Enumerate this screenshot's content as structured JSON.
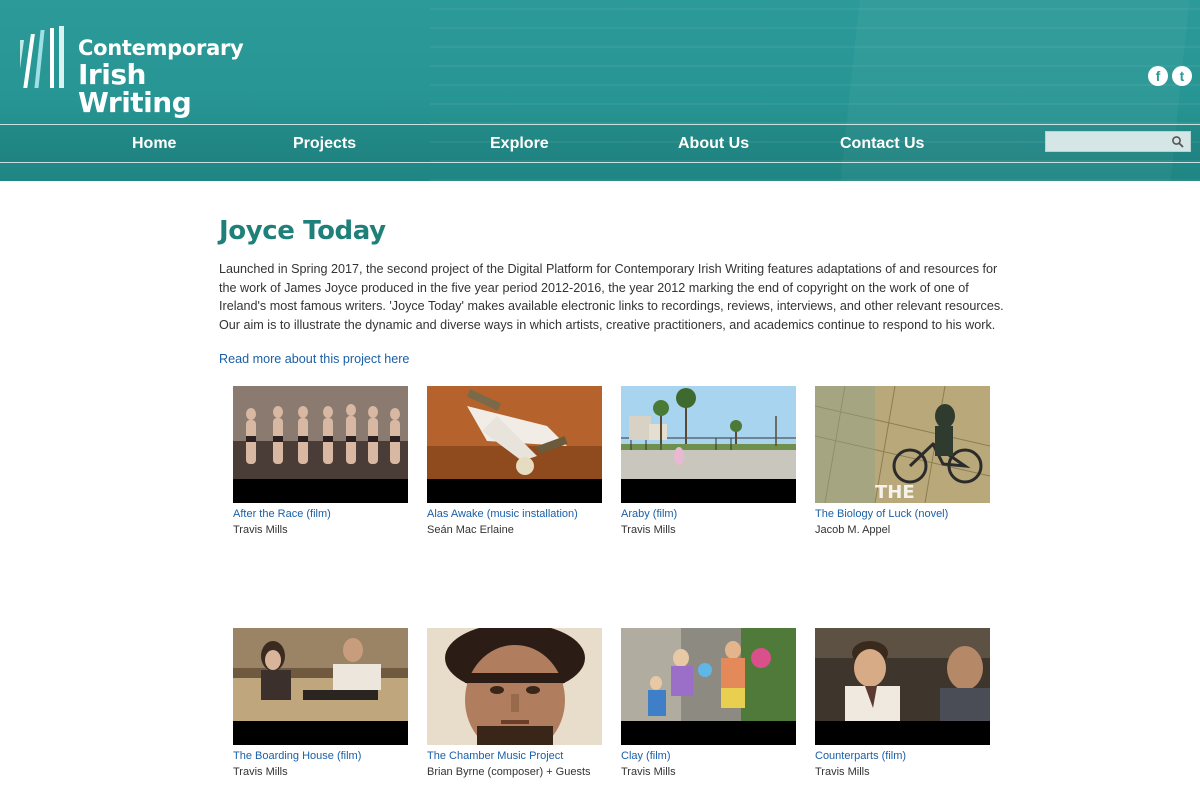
{
  "brand": {
    "line1": "Contemporary",
    "line2": "Irish Writing",
    "accent": "#1f7f79",
    "header_color": "#2b9a98"
  },
  "social": [
    {
      "icon": "facebook-icon",
      "glyph": "f"
    },
    {
      "icon": "twitter-icon",
      "glyph": "t"
    }
  ],
  "nav": {
    "items": [
      "Home",
      "Projects",
      "Explore",
      "About Us",
      "Contact Us"
    ]
  },
  "search": {
    "placeholder": ""
  },
  "page": {
    "title": "Joyce Today",
    "intro": "Launched in Spring 2017, the second project of the Digital Platform for Contemporary Irish Writing features adaptations of and resources for the work of James Joyce produced in the five year period 2012-2016, the year 2012 marking the end of copyright on the work of one of Ireland's most famous writers. 'Joyce Today' makes available electronic links to recordings, reviews, interviews, and other relevant resources. Our aim is to illustrate the dynamic and diverse ways in which artists, creative practitioners, and academics continue to respond to his work.",
    "read_more": "Read more about this project here"
  },
  "items": [
    {
      "title": "After the Race (film)",
      "author": "Travis Mills"
    },
    {
      "title": "Alas Awake (music installation)",
      "author": "Seán Mac Erlaine"
    },
    {
      "title": "Araby (film)",
      "author": "Travis Mills"
    },
    {
      "title": "The Biology of Luck (novel)",
      "author": "Jacob M. Appel"
    },
    {
      "title": "The Boarding House (film)",
      "author": "Travis Mills"
    },
    {
      "title": "The Chamber Music Project",
      "author": "Brian Byrne (composer) + Guests"
    },
    {
      "title": "Clay (film)",
      "author": "Travis Mills"
    },
    {
      "title": "Counterparts (film)",
      "author": "Travis Mills"
    }
  ]
}
